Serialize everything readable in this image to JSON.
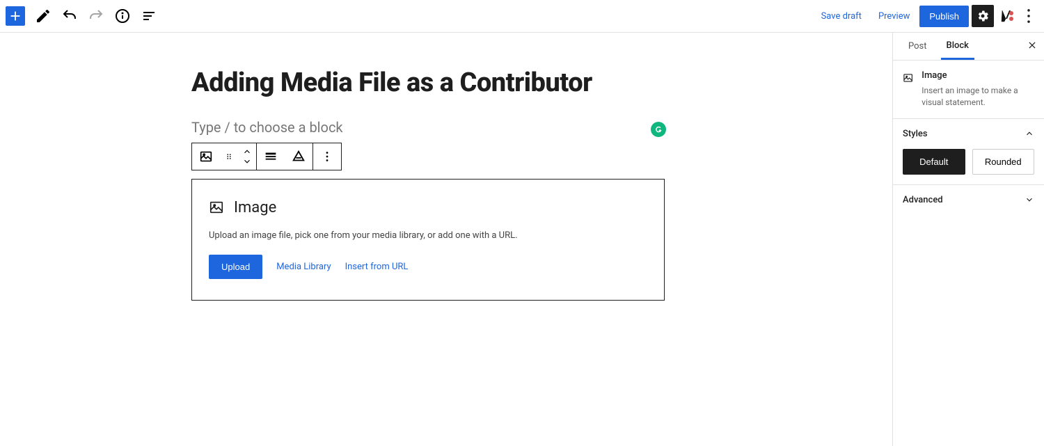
{
  "toolbar": {
    "save_draft": "Save draft",
    "preview": "Preview",
    "publish": "Publish"
  },
  "editor": {
    "title": "Adding Media File as a Contributor",
    "placeholder": "Type / to choose a block"
  },
  "image_block": {
    "heading": "Image",
    "description": "Upload an image file, pick one from your media library, or add one with a URL.",
    "upload_label": "Upload",
    "media_library_label": "Media Library",
    "insert_url_label": "Insert from URL"
  },
  "sidebar": {
    "tab_post": "Post",
    "tab_block": "Block",
    "block_name": "Image",
    "block_description": "Insert an image to make a visual statement.",
    "styles_label": "Styles",
    "style_default": "Default",
    "style_rounded": "Rounded",
    "advanced_label": "Advanced"
  }
}
